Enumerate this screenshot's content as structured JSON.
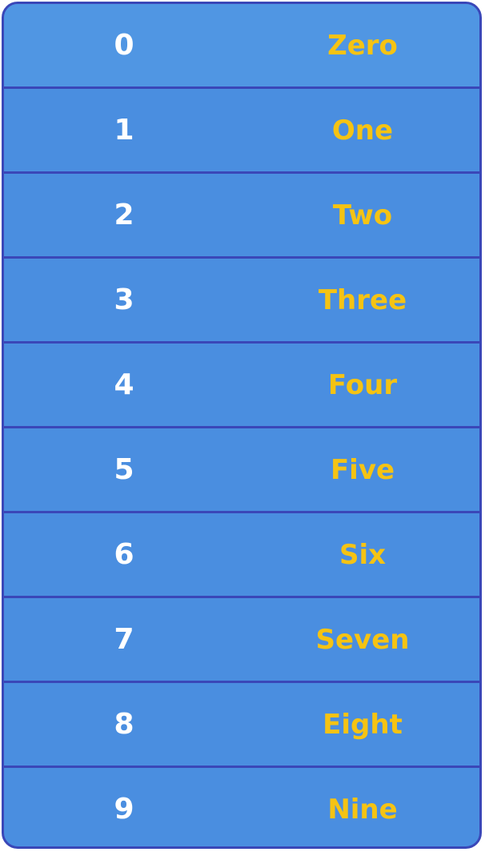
{
  "colors": {
    "background": "#4a8ee0",
    "border": "#3a47b8",
    "digit_text": "#ffffff",
    "word_text": "#f5c313"
  },
  "rows": [
    {
      "digit": "0",
      "word": "Zero"
    },
    {
      "digit": "1",
      "word": "One"
    },
    {
      "digit": "2",
      "word": "Two"
    },
    {
      "digit": "3",
      "word": "Three"
    },
    {
      "digit": "4",
      "word": "Four"
    },
    {
      "digit": "5",
      "word": "Five"
    },
    {
      "digit": "6",
      "word": "Six"
    },
    {
      "digit": "7",
      "word": "Seven"
    },
    {
      "digit": "8",
      "word": "Eight"
    },
    {
      "digit": "9",
      "word": "Nine"
    }
  ]
}
